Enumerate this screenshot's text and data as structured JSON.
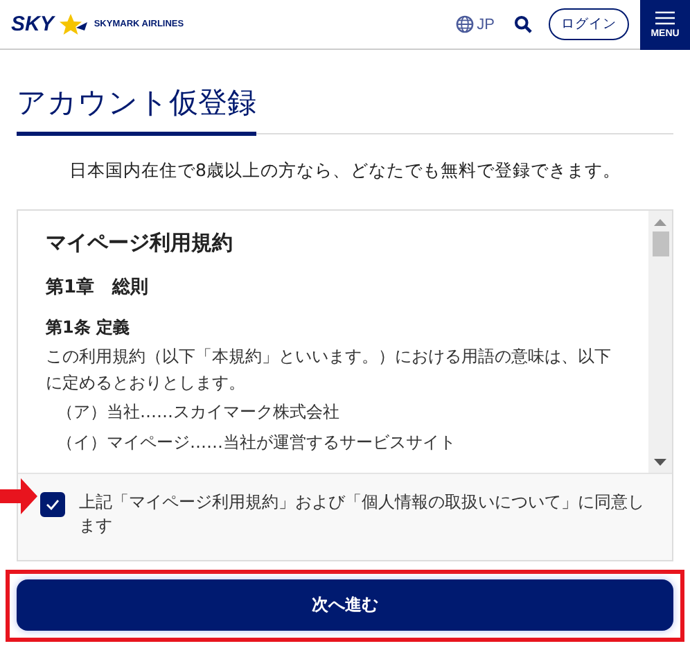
{
  "header": {
    "logo_mark": "SKY",
    "logo_text": "SKYMARK AIRLINES",
    "language": "JP",
    "login": "ログイン",
    "menu": "MENU"
  },
  "title": "アカウント仮登録",
  "intro": "日本国内在住で8歳以上の方なら、どなたでも無料で登録できます。",
  "terms": {
    "heading": "マイページ利用規約",
    "chapter": "第1章　総則",
    "article": "第1条 定義",
    "paragraph": "この利用規約（以下「本規約」といいます。）における用語の意味は、以下に定めるとおりとします。",
    "items": [
      "（ア）当社……スカイマーク株式会社",
      "（イ）マイページ……当社が運営するサービスサイト"
    ]
  },
  "agree": {
    "label": "上記「マイページ利用規約」および「個人情報の取扱いについて」に同意します",
    "checked": true
  },
  "next_button": "次へ進む"
}
